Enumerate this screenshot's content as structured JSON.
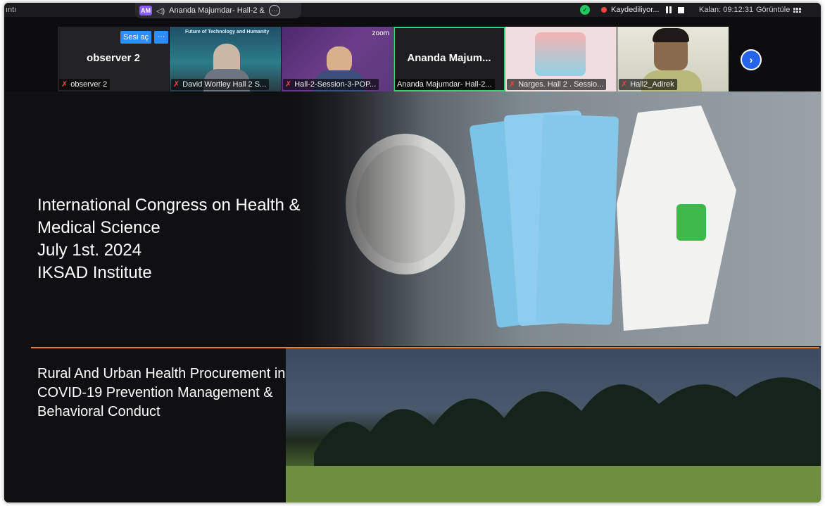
{
  "topbar": {
    "left_label": "ıntı",
    "speaker_initials": "AM",
    "speaker_name": "Ananda Majumdar- Hall-2 &",
    "recording_text": "Kaydediliyor...",
    "timer_text": "Kalan: 09:12:31",
    "view_label": "Görüntüle"
  },
  "participants": [
    {
      "label": "observer 2",
      "center_name": "observer 2",
      "unmute": "Sesi aç",
      "more": "···"
    },
    {
      "label": "David Wortley Hall 2 S...",
      "banner": "Future of Technology and Humanity"
    },
    {
      "label": "Hall-2-Session-3-POP...",
      "logo": "zoom"
    },
    {
      "label": "Ananda Majumdar- Hall-2...",
      "center_name": "Ananda  Majum...",
      "active": true
    },
    {
      "label": "Narges. Hall 2 . Sessio..."
    },
    {
      "label": "Hall2_Adirek"
    }
  ],
  "slide": {
    "title_lines": [
      "International Congress on Health &",
      "Medical Science",
      "July 1st. 2024",
      "IKSAD Institute"
    ],
    "subtitle_lines": [
      "Rural And Urban Health Procurement  in",
      "COVID-19 Prevention Management &",
      "Behavioral Conduct"
    ]
  },
  "colors": {
    "accent": "#2d8cff",
    "active_border": "#2fd47a",
    "divider": "#e0803a"
  }
}
